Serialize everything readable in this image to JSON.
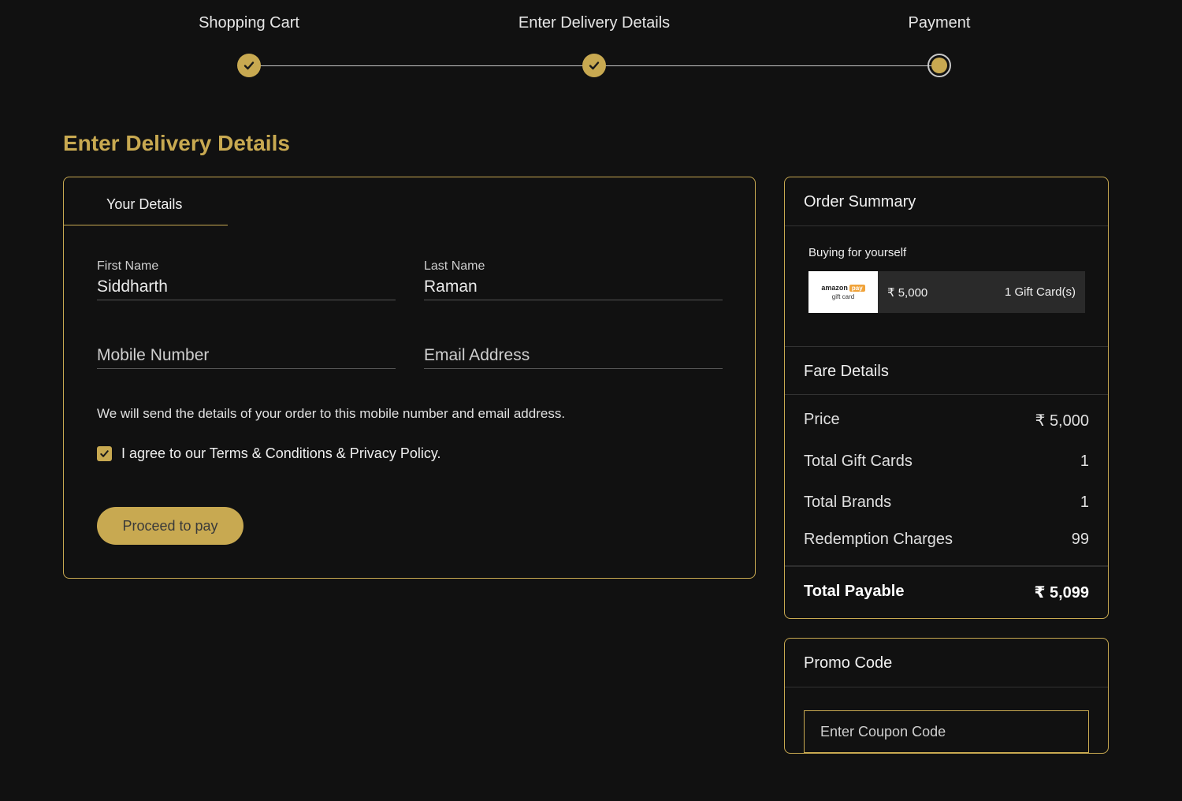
{
  "stepper": {
    "steps": [
      {
        "label": "Shopping Cart",
        "state": "done"
      },
      {
        "label": "Enter Delivery Details",
        "state": "done"
      },
      {
        "label": "Payment",
        "state": "current"
      }
    ]
  },
  "page_title": "Enter Delivery Details",
  "details": {
    "tab_label": "Your Details",
    "first_name": {
      "label": "First Name",
      "value": "Siddharth"
    },
    "last_name": {
      "label": "Last Name",
      "value": "Raman"
    },
    "mobile": {
      "placeholder": "Mobile Number"
    },
    "email": {
      "placeholder": "Email Address"
    },
    "note": "We will send the details of your order to this mobile number and email address.",
    "agree_text": "I agree to our Terms & Conditions & Privacy Policy.",
    "agree_checked": true,
    "proceed_label": "Proceed to pay"
  },
  "order_summary": {
    "title": "Order Summary",
    "buying_for": "Buying for yourself",
    "card": {
      "brand_top": "amazon",
      "brand_badge": "pay",
      "brand_bottom": "gift card",
      "amount": "₹  5,000",
      "count": "1 Gift Card(s)"
    }
  },
  "fare_details": {
    "title": "Fare Details",
    "rows": [
      {
        "key": "Price",
        "value": "₹ 5,000"
      },
      {
        "key": "Total Gift Cards",
        "value": "1"
      },
      {
        "key": "Total Brands",
        "value": "1"
      },
      {
        "key": "Redemption Charges",
        "value": "99"
      }
    ],
    "total": {
      "key": "Total Payable",
      "value": "₹ 5,099"
    }
  },
  "promo": {
    "title": "Promo Code",
    "placeholder": "Enter Coupon Code"
  },
  "colors": {
    "accent": "#c8a951",
    "background": "#111111"
  }
}
